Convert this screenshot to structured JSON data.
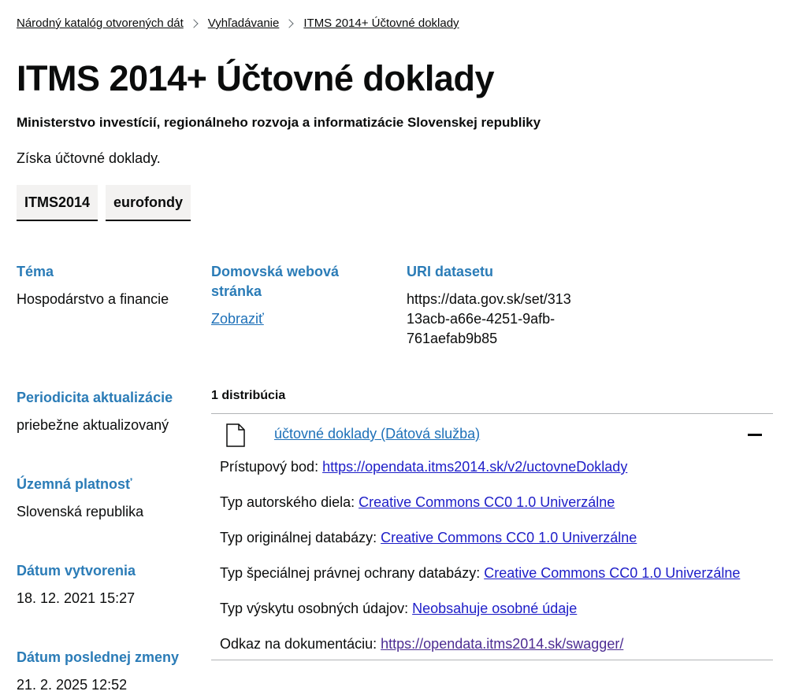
{
  "breadcrumb": {
    "items": [
      "Národný katalóg otvorených dát",
      "Vyhľadávanie",
      "ITMS 2014+ Účtovné doklady"
    ]
  },
  "title": "ITMS 2014+ Účtovné doklady",
  "publisher": "Ministerstvo investícií, regionálneho rozvoja a informatizácie Slovenskej republiky",
  "description": "Získa účtovné doklady.",
  "tags": [
    "ITMS2014",
    "eurofondy"
  ],
  "meta": {
    "tema_label": "Téma",
    "tema_value": "Hospodárstvo a financie",
    "homepage_label_line1": "Domovská webová",
    "homepage_label_line2": "stránka",
    "homepage_link": "Zobraziť",
    "uri_label": "URI datasetu",
    "uri_line1": "https://data.gov.sk/set/313",
    "uri_line2": "13acb-a66e-4251-9afb-",
    "uri_line3": "761aefab9b85",
    "periodicita_label": "Periodicita aktualizácie",
    "periodicita_value": "priebežne aktualizovaný",
    "uzemna_label": "Územná platnosť",
    "uzemna_value": "Slovenská republika",
    "vytvorenie_label": "Dátum vytvorenia",
    "vytvorenie_value": "18. 12. 2021 15:27",
    "zmena_label": "Dátum poslednej zmeny",
    "zmena_value": "21. 2. 2025 12:52"
  },
  "distributions": {
    "count_label": "1 distribúcia",
    "item": {
      "title": "účtovné doklady (Dátová služba)",
      "access_label": "Prístupový bod:",
      "access_value": "https://opendata.itms2014.sk/v2/uctovneDoklady",
      "author_label": "Typ autorského diela:",
      "author_value": "Creative Commons CC0 1.0 Univerzálne",
      "db_label": "Typ originálnej databázy:",
      "db_value": "Creative Commons CC0 1.0 Univerzálne",
      "special_label": "Typ špeciálnej právnej ochrany databázy:",
      "special_value": "Creative Commons CC0 1.0 Univerzálne",
      "personal_label": "Typ výskytu osobných údajov:",
      "personal_value": "Neobsahuje osobné údaje",
      "doc_label": "Odkaz na dokumentáciu:",
      "doc_value": "https://opendata.itms2014.sk/swagger/"
    }
  }
}
